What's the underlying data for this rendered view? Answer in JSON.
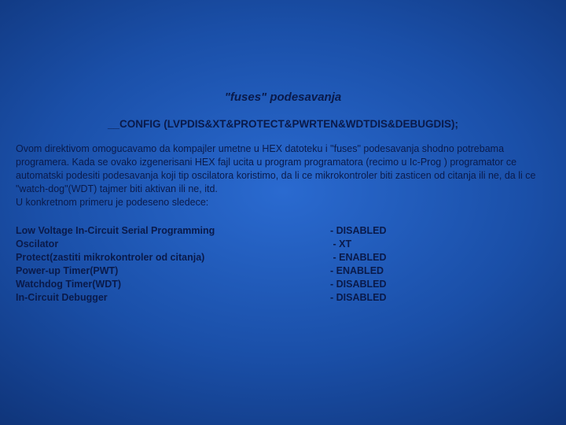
{
  "title": "\"fuses\" podesavanja",
  "directive": "__CONFIG (LVPDIS&XT&PROTECT&PWRTEN&WDTDIS&DEBUGDIS);",
  "paragraph": "Ovom direktivom omogucavamo da kompajler umetne u HEX datoteku i \"fuses\" podesavanja shodno potrebama programera. Kada se ovako izgenerisani HEX fajl ucita u program programatora (recimo u Ic-Prog ) programator ce automatski podesiti podesavanja koji tip oscilatora koristimo, da li ce mikrokontroler biti zasticen od citanja ili ne, da li ce \"watch-dog\"(WDT) tajmer biti aktivan ili ne, itd.\nU konkretnom primeru je podeseno sledece:",
  "settings": [
    {
      "label": "Low Voltage In-Circuit Serial Programming",
      "value": "- DISABLED"
    },
    {
      "label": "Oscilator",
      "value": " - XT"
    },
    {
      "label": "Protect(zastiti mikrokontroler od citanja)",
      "value": " - ENABLED"
    },
    {
      "label": "Power-up Timer(PWT)",
      "value": "- ENABLED"
    },
    {
      "label": "Watchdog Timer(WDT)",
      "value": "- DISABLED"
    },
    {
      "label": "In-Circuit Debugger",
      "value": "- DISABLED"
    }
  ]
}
